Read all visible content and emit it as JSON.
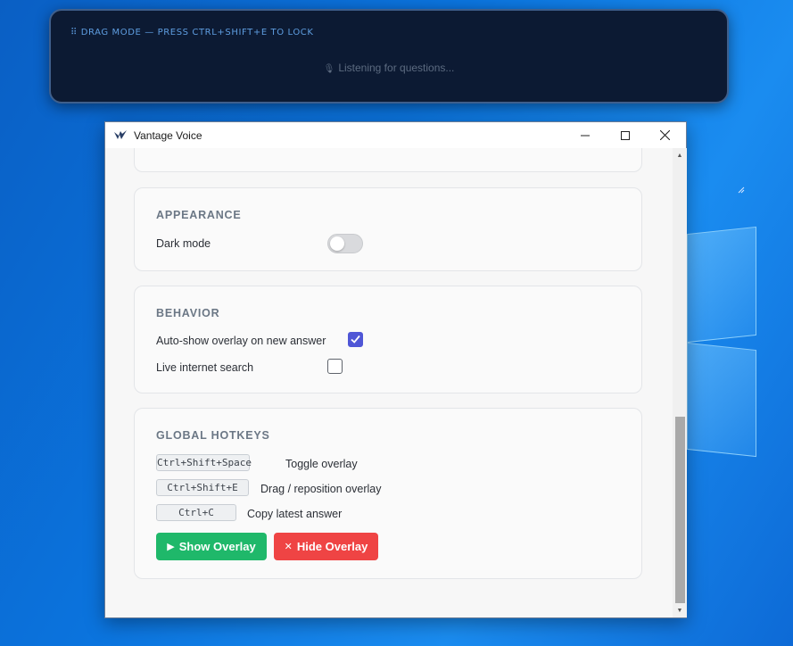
{
  "overlay": {
    "drag_hint": "⠿ DRAG MODE — PRESS CTRL+SHIFT+E TO LOCK",
    "status": "Listening for questions...",
    "mic_icon": "🎙"
  },
  "window": {
    "title": "Vantage Voice",
    "controls": {
      "minimize": "—",
      "maximize": "☐",
      "close": "✕"
    }
  },
  "appearance": {
    "title": "APPEARANCE",
    "dark_mode_label": "Dark mode",
    "dark_mode_on": false
  },
  "behavior": {
    "title": "BEHAVIOR",
    "auto_show_label": "Auto-show overlay on new answer",
    "auto_show_checked": true,
    "live_search_label": "Live internet search",
    "live_search_checked": false
  },
  "hotkeys": {
    "title": "GLOBAL HOTKEYS",
    "items": [
      {
        "keys": "Ctrl+Shift+Space",
        "desc": "Toggle overlay"
      },
      {
        "keys": "Ctrl+Shift+E",
        "desc": "Drag / reposition overlay"
      },
      {
        "keys": "Ctrl+C",
        "desc": "Copy latest answer"
      }
    ],
    "show_button": "Show Overlay",
    "hide_button": "Hide Overlay",
    "show_icon": "▶",
    "hide_icon": "✕"
  },
  "colors": {
    "accent_checkbox": "#4f56d6",
    "show_button": "#1fb86a",
    "hide_button": "#ef4444",
    "overlay_bg": "#0c1a33"
  }
}
